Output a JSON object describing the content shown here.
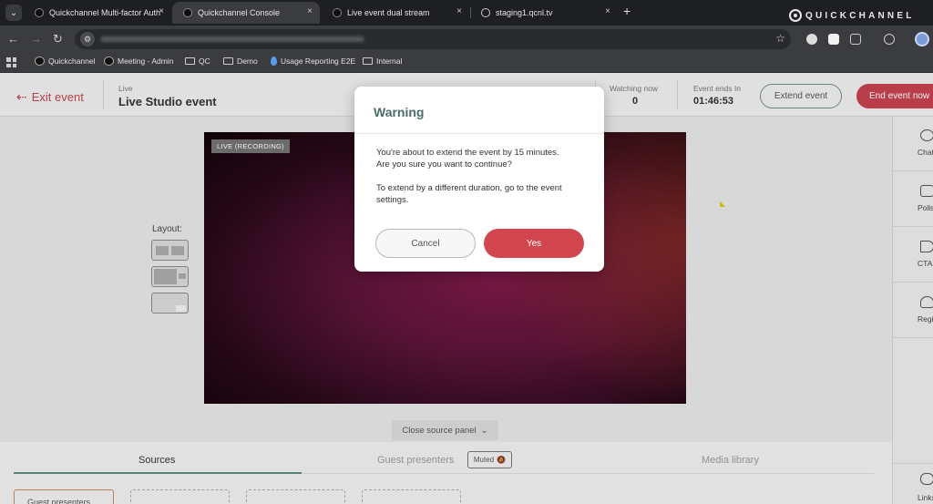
{
  "browser": {
    "tabs": [
      {
        "title": "Quickchannel Multi-factor Auth",
        "active": false
      },
      {
        "title": "Quickchannel Console",
        "active": true
      },
      {
        "title": "Live event dual stream",
        "active": false
      },
      {
        "title": "staging1.qcnl.tv",
        "active": false
      }
    ],
    "close_glyph": "×",
    "new_tab_glyph": "+",
    "brand": "QUICKCHANNEL",
    "bookmarks": [
      {
        "label": "Quickchannel",
        "icon": "quickchannel-logo-icon"
      },
      {
        "label": "Meeting - Admin",
        "icon": "quickchannel-logo-icon"
      },
      {
        "label": "QC",
        "icon": "folder-icon"
      },
      {
        "label": "Demo",
        "icon": "folder-icon"
      },
      {
        "label": "Usage Reporting E2E",
        "icon": "drop-icon"
      },
      {
        "label": "Internal",
        "icon": "folder-icon"
      }
    ]
  },
  "header": {
    "exit_label": "Exit event",
    "status": "Live",
    "title": "Live Studio event",
    "watching_label": "Watching now",
    "watching_value": "0",
    "ends_label": "Event ends In",
    "ends_value": "01:46:53",
    "extend_label": "Extend event",
    "end_label": "End event now"
  },
  "stage": {
    "badge": "LIVE (RECORDING)",
    "layout_label": "Layout:"
  },
  "sidebar": {
    "items": [
      {
        "label": "Chat",
        "icon": "chat-icon"
      },
      {
        "label": "Polls",
        "icon": "poll-icon"
      },
      {
        "label": "CTA",
        "icon": "megaphone-icon"
      },
      {
        "label": "Registrations",
        "icon": "users-icon"
      },
      {
        "label": "Links",
        "icon": "link-icon"
      }
    ]
  },
  "panel": {
    "close_label": "Close source panel",
    "tabs": [
      "Sources",
      "Guest presenters",
      "Media library"
    ],
    "muted_label": "Muted",
    "guest_button": "Guest presenters"
  },
  "modal": {
    "title": "Warning",
    "line1": "You're about to extend the event by 15 minutes.",
    "line2": "Are you sure you want to continue?",
    "line3": "To extend by a different duration, go to the event settings.",
    "cancel": "Cancel",
    "confirm": "Yes"
  },
  "colors": {
    "accent_red": "#c4424d",
    "accent_teal": "#5b8a7f"
  }
}
